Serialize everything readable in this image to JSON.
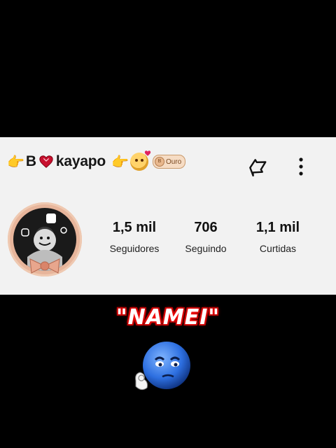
{
  "profile": {
    "name_prefix": "B",
    "name_suffix": "kayapo",
    "badge_label": "Ouro",
    "badge_icon_text": "B"
  },
  "stats": [
    {
      "value": "1,5 mil",
      "label": "Seguidores"
    },
    {
      "value": "706",
      "label": "Seguindo"
    },
    {
      "value": "1,1 mil",
      "label": "Curtidas"
    }
  ],
  "caption": "\"NAMEI\"",
  "icons": {
    "pointing_hand": "👉",
    "share": "share-icon",
    "more": "more-vertical-icon",
    "overlay_emoji": "blue-ok-face"
  },
  "colors": {
    "card_bg": "#f2f2f2",
    "page_bg": "#000000",
    "badge_border": "#c99a6c",
    "caption_glow": "#ff1a1a",
    "avatar_ring": "#e7b59b"
  }
}
